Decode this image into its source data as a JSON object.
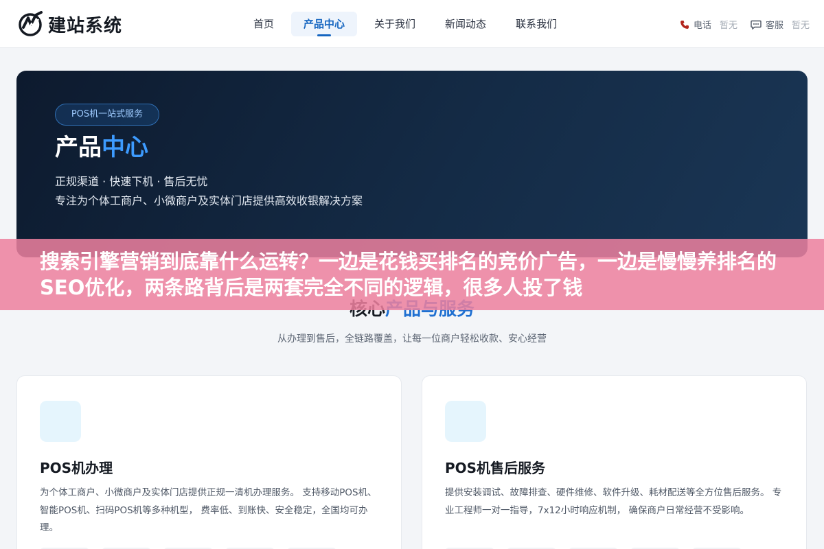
{
  "header": {
    "logo_text": "建站系统",
    "nav": [
      {
        "label": "首页",
        "active": false
      },
      {
        "label": "产品中心",
        "active": true
      },
      {
        "label": "关于我们",
        "active": false
      },
      {
        "label": "新闻动态",
        "active": false
      },
      {
        "label": "联系我们",
        "active": false
      }
    ],
    "phone": {
      "label": "电话",
      "value": "暂无",
      "icon": "phone-icon"
    },
    "service": {
      "label": "客服",
      "value": "暂无",
      "icon": "chat-icon"
    }
  },
  "hero": {
    "badge": "POS机一站式服务",
    "title_main": "产品",
    "title_accent": "中心",
    "subtitle_1": "正规渠道 · 快速下机 · 售后无忧",
    "subtitle_2": "专注为个体工商户、小微商户及实体门店提供高效收银解决方案"
  },
  "section": {
    "title_main": "核心",
    "title_accent": "产品与服务",
    "subtitle": "从办理到售后，全链路覆盖，让每一位商户轻松收款、安心经营"
  },
  "cards": [
    {
      "title": "POS机办理",
      "desc": "为个体工商户、小微商户及实体门店提供正规一清机办理服务。 支持移动POS机、智能POS机、扫码POS机等多种机型， 费率低、到账快、安全稳定，全国均可办理。"
    },
    {
      "title": "POS机售后服务",
      "desc": "提供安装调试、故障排查、硬件维修、软件升级、耗材配送等全方位售后服务。 专业工程师一对一指导，7x12小时响应机制， 确保商户日常经营不受影响。"
    }
  ],
  "overlay": {
    "text": "搜索引擎营销到底靠什么运转？一边是花钱买排名的竞价广告，一边是慢慢养排名的SEO优化，两条路背后是两套完全不同的逻辑，很多人投了钱"
  },
  "colors": {
    "accent": "#1565c0",
    "hero_bg": "#0d1a2e",
    "overlay": "#ec809e"
  }
}
